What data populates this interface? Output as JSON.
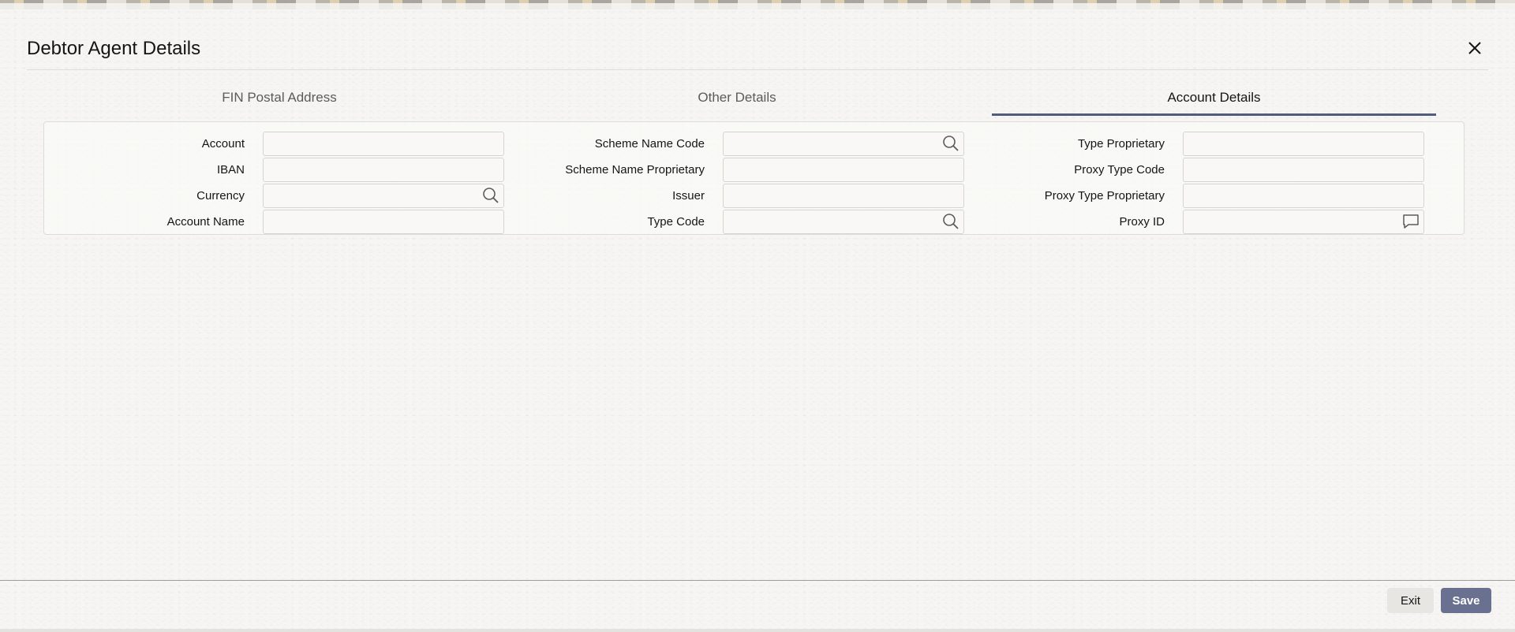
{
  "dialog": {
    "title": "Debtor Agent Details",
    "close_icon": "close-icon"
  },
  "tabs": [
    {
      "label": "FIN Postal Address",
      "active": false
    },
    {
      "label": "Other Details",
      "active": false
    },
    {
      "label": "Account Details",
      "active": true
    }
  ],
  "fields": {
    "account": {
      "label": "Account",
      "value": ""
    },
    "iban": {
      "label": "IBAN",
      "value": ""
    },
    "currency": {
      "label": "Currency",
      "value": "",
      "icon": "search-icon"
    },
    "account_name": {
      "label": "Account Name",
      "value": ""
    },
    "scheme_name_code": {
      "label": "Scheme Name Code",
      "value": "",
      "icon": "search-icon"
    },
    "scheme_name_proprietary": {
      "label": "Scheme Name Proprietary",
      "value": ""
    },
    "issuer": {
      "label": "Issuer",
      "value": ""
    },
    "type_code": {
      "label": "Type Code",
      "value": "",
      "icon": "search-icon"
    },
    "type_proprietary": {
      "label": "Type Proprietary",
      "value": ""
    },
    "proxy_type_code": {
      "label": "Proxy Type Code",
      "value": ""
    },
    "proxy_type_proprietary": {
      "label": "Proxy Type Proprietary",
      "value": ""
    },
    "proxy_id": {
      "label": "Proxy ID",
      "value": "",
      "icon": "comment-icon"
    }
  },
  "footer": {
    "exit_label": "Exit",
    "save_label": "Save"
  },
  "colors": {
    "active_tab_underline": "#535b7a",
    "save_button": "#6a7090",
    "exit_button": "#e8e6e3"
  }
}
